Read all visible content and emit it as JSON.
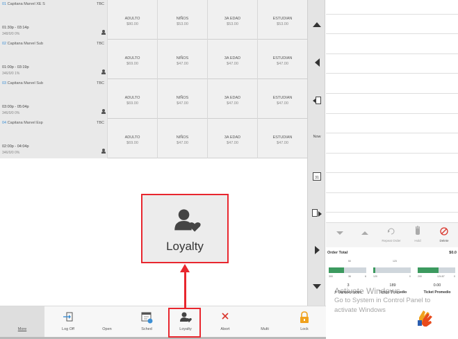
{
  "showtimes": [
    {
      "num": "01",
      "title": "Capitana Marvel XE S",
      "tbc": "TBC",
      "time": "01:30p - 03:14p",
      "capacity": "348/0/0   0%",
      "prices": [
        {
          "name": "ADULTO",
          "price": "$80.00"
        },
        {
          "name": "NIÑOS",
          "price": "$53.00"
        },
        {
          "name": "3A EDAD",
          "price": "$53.00"
        },
        {
          "name": "ESTUDIAN",
          "price": "$53.00"
        }
      ]
    },
    {
      "num": "02",
      "title": "Capitana Marvel Sub",
      "tbc": "TBC",
      "time": "01:00p - 03:19p",
      "capacity": "346/0/0   1%",
      "prices": [
        {
          "name": "ADULTO",
          "price": "$69.00"
        },
        {
          "name": "NIÑOS",
          "price": "$47.00"
        },
        {
          "name": "3A EDAD",
          "price": "$47.00"
        },
        {
          "name": "ESTUDIAN",
          "price": "$47.00"
        }
      ]
    },
    {
      "num": "03",
      "title": "Capitana Marvel Sub",
      "tbc": "TBC",
      "time": "03:00p - 05:04p",
      "capacity": "346/0/0   0%",
      "prices": [
        {
          "name": "ADULTO",
          "price": "$69.00"
        },
        {
          "name": "NIÑOS",
          "price": "$47.00"
        },
        {
          "name": "3A EDAD",
          "price": "$47.00"
        },
        {
          "name": "ESTUDIAN",
          "price": "$47.00"
        }
      ]
    },
    {
      "num": "04",
      "title": "Capitana Marvel Esp",
      "tbc": "TBC",
      "time": "02:00p - 04:04p",
      "capacity": "346/0/0   0%",
      "prices": [
        {
          "name": "ADULTO",
          "price": "$69.00"
        },
        {
          "name": "NIÑOS",
          "price": "$47.00"
        },
        {
          "name": "3A EDAD",
          "price": "$47.00"
        },
        {
          "name": "ESTUDIAN",
          "price": "$47.00"
        }
      ]
    }
  ],
  "nav": {
    "now_label": "Now",
    "calendar_label": "31"
  },
  "order": {
    "actions": [
      {
        "label": ""
      },
      {
        "label": ""
      },
      {
        "label": "Repeat Order"
      },
      {
        "label": "Hold"
      },
      {
        "label": "Delete"
      }
    ],
    "total_label": "Order Total",
    "total_value": "$0.0",
    "gauges": [
      {
        "label": "# Transacciones",
        "value": "3",
        "target": "50",
        "fill": 0.4,
        "min": "300",
        "mid": "36",
        "max": "6"
      },
      {
        "label": "Tempo Promedio",
        "value": "189",
        "target": "123",
        "fill": 0.05,
        "min": "120",
        "max": "0"
      },
      {
        "label": "Ticket Promedio",
        "value": "0.00",
        "target": "",
        "fill": 0.55,
        "min": "200",
        "mid": "124.87",
        "max": "0"
      }
    ]
  },
  "watermark": {
    "line1": "Activate Windows",
    "line2": "Go to System in Control Panel to",
    "line3": "activate Windows"
  },
  "toolbar": [
    {
      "label": "More",
      "icon": "none"
    },
    {
      "label": "Log Off",
      "icon": "log-off-icon"
    },
    {
      "label": "Open",
      "icon": "none"
    },
    {
      "label": "Sched",
      "icon": "schedule-icon"
    },
    {
      "label": "Loyalty",
      "icon": "loyalty-icon"
    },
    {
      "label": "Abort",
      "icon": "close-icon"
    },
    {
      "label": "Multi",
      "icon": "none"
    },
    {
      "label": "Lock",
      "icon": "lock-icon"
    }
  ],
  "callout": {
    "label": "Loyalty"
  },
  "colors": {
    "highlight": "#e8262e",
    "accent_blue": "#3d8fd4",
    "gauge_green": "#3c9a5f",
    "abort_red": "#d9342b",
    "lock_orange": "#f0a21e"
  }
}
